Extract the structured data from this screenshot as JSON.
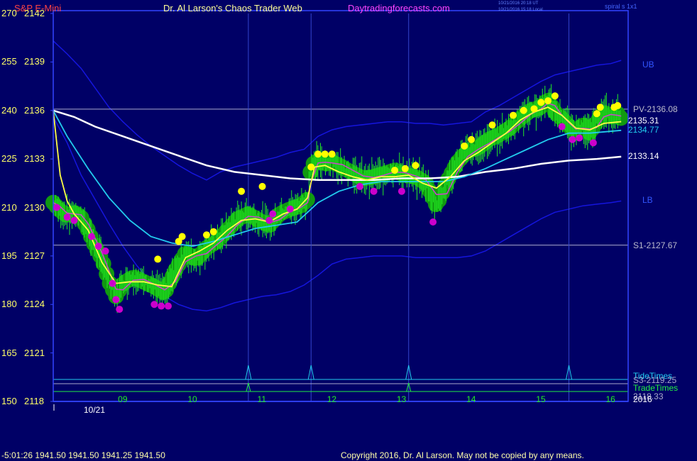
{
  "header": {
    "symbol": "S&P E-Mini",
    "title": "Dr. Al Larson's Chaos Trader Web",
    "site": "Daytradingforecasts.com",
    "timestamp_utc": "10/21/2016 20:18 UT",
    "timestamp_local": "10/21/2016 15:18 Local",
    "spiral_label": "spiral s 1x1"
  },
  "footer": {
    "readout": "-5:01:26  1941.50 1941.50 1941.25 1941.50",
    "copyright": "Copyright 2016, Dr. Al Larson. May not be copied by any means."
  },
  "colors": {
    "background": "#000066",
    "frame": "#3344ff",
    "price_bars": "#22ee22",
    "balls": "#119911",
    "yellow_dots": "#ffff00",
    "magenta_dots": "#cc00cc",
    "fast_ma": "#ffff44",
    "cyan_ma": "#22ccee",
    "white_ma": "#ffffff",
    "bands": "#1515dd",
    "tide": "#22ccee",
    "trade": "#22ee44"
  },
  "chart_data": {
    "type": "line",
    "x_axis": {
      "unit": "hour",
      "range": [
        8.0,
        16.25
      ],
      "date_label": "10/21",
      "year_label": "2016",
      "ticks": [
        {
          "label": "09",
          "value": 9
        },
        {
          "label": "10",
          "value": 10
        },
        {
          "label": "11",
          "value": 11
        },
        {
          "label": "12",
          "value": 12
        },
        {
          "label": "13",
          "value": 13
        },
        {
          "label": "14",
          "value": 14
        },
        {
          "label": "15",
          "value": 15
        },
        {
          "label": "16",
          "value": 16
        }
      ]
    },
    "y_axis": {
      "range": [
        2118,
        2142
      ],
      "ticks": [
        {
          "left": "270",
          "right": "2142",
          "value": 2142
        },
        {
          "left": "255",
          "right": "2139",
          "value": 2139
        },
        {
          "left": "240",
          "right": "2136",
          "value": 2136
        },
        {
          "left": "225",
          "right": "2133",
          "value": 2133
        },
        {
          "left": "210",
          "right": "2130",
          "value": 2130
        },
        {
          "left": "195",
          "right": "2127",
          "value": 2127
        },
        {
          "left": "180",
          "right": "2124",
          "value": 2124
        },
        {
          "left": "165",
          "right": "2121",
          "value": 2121
        },
        {
          "left": "150",
          "right": "2118",
          "value": 2118
        }
      ]
    },
    "levels": [
      {
        "label": "PV-2136.08",
        "value": 2136.08
      },
      {
        "label": "S1-2127.67",
        "value": 2127.67
      }
    ],
    "band_labels": {
      "upper": "UB",
      "lower": "LB"
    },
    "end_values": [
      {
        "label": "2135.31",
        "value": 2135.31,
        "series": "fast_ma"
      },
      {
        "label": "2134.77",
        "value": 2134.77,
        "series": "cyan_ma"
      },
      {
        "label": "2133.14",
        "value": 2133.14,
        "series": "white_ma"
      }
    ],
    "indicators": {
      "tide_label": "TideTimes",
      "trade_label": "TradeTimes",
      "s3_label": "S3-2119.25",
      "s3_value": 2119.25,
      "extra_label": "2118.33",
      "tide_spikes": [
        10.8,
        11.7,
        13.1,
        15.4
      ],
      "trade_spikes": [
        10.8,
        13.1
      ]
    },
    "vertical_markers": [
      10.8,
      11.7,
      13.1,
      15.4
    ],
    "price": {
      "x": [
        8.0,
        8.1,
        8.2,
        8.3,
        8.4,
        8.5,
        8.6,
        8.7,
        8.8,
        8.9,
        9.0,
        9.15,
        9.3,
        9.45,
        9.6,
        9.75,
        9.9,
        10.05,
        10.2,
        10.35,
        10.5,
        10.65,
        10.8,
        10.95,
        11.1,
        11.25,
        11.4,
        11.55,
        11.65,
        11.7,
        11.8,
        11.9,
        12.0,
        12.15,
        12.3,
        12.45,
        12.6,
        12.75,
        12.9,
        13.05,
        13.2,
        13.35,
        13.5,
        13.65,
        13.8,
        13.95,
        14.1,
        14.25,
        14.4,
        14.55,
        14.7,
        14.85,
        15.0,
        15.1,
        15.2,
        15.3,
        15.4,
        15.5,
        15.6,
        15.7,
        15.8,
        15.9,
        16.0,
        16.1,
        16.15
      ],
      "y": [
        2130.3,
        2129.8,
        2129.5,
        2129.7,
        2129.4,
        2128.6,
        2127.6,
        2126.8,
        2125.4,
        2124.5,
        2125.3,
        2125.7,
        2125.4,
        2125.1,
        2124.7,
        2126.1,
        2127.2,
        2126.8,
        2127.5,
        2127.9,
        2128.6,
        2129.3,
        2129.6,
        2129.2,
        2128.9,
        2129.6,
        2129.9,
        2130.1,
        2130.5,
        2132.6,
        2132.9,
        2132.7,
        2132.8,
        2132.5,
        2132.1,
        2131.8,
        2131.9,
        2132.1,
        2132.3,
        2132.0,
        2131.9,
        2131.5,
        2130.1,
        2131.6,
        2132.8,
        2133.5,
        2133.7,
        2134.2,
        2134.5,
        2134.9,
        2135.5,
        2136.0,
        2136.2,
        2136.7,
        2135.9,
        2135.5,
        2135.0,
        2134.7,
        2135.1,
        2134.6,
        2135.3,
        2135.9,
        2135.6,
        2135.8,
        2135.5
      ]
    },
    "series": [
      {
        "name": "",
        "key": "fast_ma",
        "x": [
          8.0,
          8.1,
          8.2,
          8.3,
          8.5,
          8.7,
          8.9,
          9.1,
          9.3,
          9.5,
          9.7,
          9.9,
          10.1,
          10.3,
          10.5,
          10.7,
          10.9,
          11.1,
          11.3,
          11.5,
          11.65,
          11.75,
          11.9,
          12.1,
          12.3,
          12.5,
          12.7,
          12.9,
          13.1,
          13.3,
          13.5,
          13.7,
          13.9,
          14.1,
          14.3,
          14.5,
          14.7,
          14.9,
          15.1,
          15.3,
          15.5,
          15.7,
          15.9,
          16.15
        ],
        "y": [
          2136.0,
          2132.0,
          2130.4,
          2129.6,
          2128.6,
          2126.6,
          2125.3,
          2125.4,
          2125.4,
          2125.2,
          2125.1,
          2126.9,
          2127.3,
          2127.8,
          2128.6,
          2129.2,
          2129.3,
          2129.1,
          2129.6,
          2129.9,
          2130.6,
          2132.5,
          2132.6,
          2132.2,
          2131.9,
          2131.7,
          2131.9,
          2131.9,
          2132.0,
          2131.5,
          2131.2,
          2131.9,
          2132.9,
          2133.4,
          2134.0,
          2134.6,
          2135.4,
          2135.9,
          2136.2,
          2135.7,
          2134.9,
          2134.8,
          2135.2,
          2135.31
        ]
      },
      {
        "name": "",
        "key": "cyan_ma",
        "x": [
          8.0,
          8.2,
          8.5,
          8.8,
          9.1,
          9.4,
          9.7,
          10.0,
          10.3,
          10.6,
          10.9,
          11.2,
          11.5,
          11.8,
          12.1,
          12.4,
          12.7,
          13.0,
          13.3,
          13.6,
          13.9,
          14.2,
          14.5,
          14.8,
          15.1,
          15.4,
          15.7,
          16.15
        ],
        "y": [
          2136.0,
          2134.4,
          2132.4,
          2130.6,
          2129.2,
          2128.2,
          2127.8,
          2127.6,
          2127.9,
          2128.3,
          2128.7,
          2128.9,
          2129.1,
          2130.3,
          2131.0,
          2131.4,
          2131.6,
          2131.6,
          2131.6,
          2131.6,
          2131.9,
          2132.4,
          2133.0,
          2133.6,
          2134.2,
          2134.6,
          2134.6,
          2134.77
        ]
      },
      {
        "name": "",
        "key": "white_ma",
        "x": [
          8.0,
          8.3,
          8.6,
          9.0,
          9.4,
          9.8,
          10.2,
          10.6,
          11.0,
          11.4,
          11.8,
          12.2,
          12.6,
          13.0,
          13.4,
          13.8,
          14.2,
          14.6,
          15.0,
          15.4,
          15.8,
          16.15
        ],
        "y": [
          2136.0,
          2135.6,
          2135.0,
          2134.4,
          2133.8,
          2133.2,
          2132.6,
          2132.2,
          2132.0,
          2131.8,
          2131.7,
          2131.7,
          2131.7,
          2131.8,
          2131.8,
          2131.9,
          2132.2,
          2132.4,
          2132.7,
          2132.9,
          2133.0,
          2133.14
        ]
      },
      {
        "name": "",
        "key": "upper_band",
        "x": [
          8.0,
          8.2,
          8.4,
          8.6,
          8.8,
          9.0,
          9.2,
          9.4,
          9.6,
          9.8,
          10.0,
          10.2,
          10.4,
          10.6,
          10.8,
          11.0,
          11.2,
          11.4,
          11.6,
          11.8,
          12.0,
          12.2,
          12.4,
          12.6,
          12.8,
          13.0,
          13.2,
          13.4,
          13.6,
          13.8,
          14.0,
          14.2,
          14.4,
          14.6,
          14.8,
          15.0,
          15.2,
          15.4,
          15.6,
          15.8,
          16.0,
          16.15
        ],
        "y": [
          2140.3,
          2139.5,
          2138.6,
          2137.4,
          2136.2,
          2135.3,
          2134.5,
          2133.8,
          2133.2,
          2132.6,
          2132.1,
          2131.7,
          2132.2,
          2132.5,
          2132.7,
          2132.9,
          2133.1,
          2133.4,
          2133.6,
          2134.4,
          2134.8,
          2135.0,
          2135.1,
          2135.2,
          2135.3,
          2135.3,
          2135.2,
          2135.2,
          2135.1,
          2135.2,
          2135.3,
          2135.9,
          2136.3,
          2136.8,
          2137.3,
          2137.8,
          2138.2,
          2138.4,
          2138.6,
          2138.8,
          2138.9,
          2139.1
        ]
      },
      {
        "name": "",
        "key": "lower_band",
        "x": [
          8.0,
          8.2,
          8.4,
          8.6,
          8.8,
          9.0,
          9.2,
          9.4,
          9.6,
          9.8,
          10.0,
          10.2,
          10.4,
          10.6,
          10.8,
          11.0,
          11.2,
          11.4,
          11.6,
          11.8,
          12.0,
          12.2,
          12.4,
          12.6,
          12.8,
          13.0,
          13.2,
          13.4,
          13.6,
          13.8,
          14.0,
          14.2,
          14.4,
          14.6,
          14.8,
          15.0,
          15.2,
          15.4,
          15.6,
          15.8,
          16.0,
          16.15
        ],
        "y": [
          2135.6,
          2134.0,
          2132.0,
          2130.5,
          2129.0,
          2127.6,
          2126.4,
          2125.4,
          2124.5,
          2124.0,
          2123.7,
          2123.6,
          2123.8,
          2124.1,
          2124.3,
          2124.5,
          2124.6,
          2124.8,
          2125.2,
          2125.8,
          2126.5,
          2126.8,
          2126.9,
          2127.0,
          2127.0,
          2127.0,
          2126.9,
          2126.9,
          2126.9,
          2126.9,
          2127.0,
          2127.3,
          2127.8,
          2128.3,
          2128.8,
          2129.3,
          2129.7,
          2129.9,
          2130.1,
          2130.2,
          2130.3,
          2130.4
        ]
      }
    ],
    "yellow_dots": [
      [
        9.5,
        2126.8
      ],
      [
        10.7,
        2131.0
      ],
      [
        11.0,
        2131.3
      ],
      [
        10.2,
        2128.3
      ],
      [
        10.3,
        2128.5
      ],
      [
        11.7,
        2132.5
      ],
      [
        11.8,
        2133.3
      ],
      [
        11.9,
        2133.3
      ],
      [
        12.0,
        2133.3
      ],
      [
        12.9,
        2132.3
      ],
      [
        13.05,
        2132.4
      ],
      [
        13.2,
        2132.6
      ],
      [
        13.9,
        2133.8
      ],
      [
        14.0,
        2134.2
      ],
      [
        14.3,
        2135.1
      ],
      [
        14.6,
        2135.7
      ],
      [
        14.75,
        2136.0
      ],
      [
        14.9,
        2136.1
      ],
      [
        15.0,
        2136.5
      ],
      [
        15.1,
        2136.6
      ],
      [
        15.2,
        2136.9
      ],
      [
        15.8,
        2135.8
      ],
      [
        15.85,
        2136.2
      ],
      [
        16.05,
        2136.2
      ],
      [
        16.1,
        2136.3
      ],
      [
        9.8,
        2127.9
      ],
      [
        9.85,
        2128.2
      ]
    ],
    "magenta_dots": [
      [
        8.05,
        2130.0
      ],
      [
        8.2,
        2129.4
      ],
      [
        8.3,
        2129.2
      ],
      [
        8.55,
        2128.2
      ],
      [
        8.65,
        2127.6
      ],
      [
        8.75,
        2127.3
      ],
      [
        8.85,
        2125.3
      ],
      [
        8.9,
        2124.3
      ],
      [
        8.95,
        2123.7
      ],
      [
        9.45,
        2124.0
      ],
      [
        9.55,
        2123.9
      ],
      [
        9.65,
        2123.9
      ],
      [
        11.1,
        2129.2
      ],
      [
        11.15,
        2129.6
      ],
      [
        12.4,
        2131.3
      ],
      [
        12.6,
        2131.0
      ],
      [
        13.0,
        2131.0
      ],
      [
        13.45,
        2129.1
      ],
      [
        15.3,
        2135.0
      ],
      [
        15.45,
        2134.2
      ],
      [
        15.55,
        2134.3
      ],
      [
        15.75,
        2134.0
      ],
      [
        11.4,
        2129.9
      ]
    ]
  }
}
